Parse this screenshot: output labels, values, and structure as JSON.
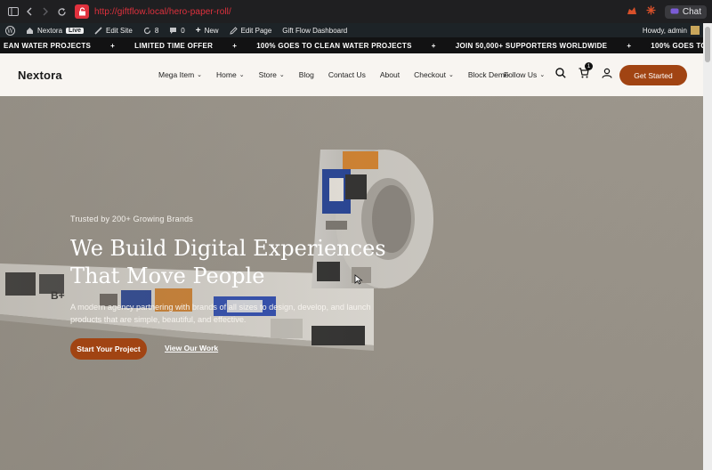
{
  "browser": {
    "url": "http://giftflow.local/hero-paper-roll/",
    "chat_label": "Chat"
  },
  "admin_bar": {
    "site_name": "Nextora",
    "live_badge": "Live",
    "edit_site": "Edit Site",
    "updates_count": "8",
    "comments_count": "0",
    "new_label": "New",
    "edit_page": "Edit Page",
    "dashboard": "Gift Flow Dashboard",
    "howdy": "Howdy, admin"
  },
  "ticker": {
    "items": [
      "EAN WATER PROJECTS",
      "LIMITED TIME OFFER",
      "100% GOES TO CLEAN WATER PROJECTS",
      "JOIN 50,000+ SUPPORTERS WORLDWIDE",
      "100% GOES TO CLEAN WATER PROJECTS"
    ],
    "separator": "+"
  },
  "header": {
    "logo": "Nextora",
    "nav": [
      {
        "label": "Mega Item",
        "has_dropdown": true
      },
      {
        "label": "Home",
        "has_dropdown": true
      },
      {
        "label": "Store",
        "has_dropdown": true
      },
      {
        "label": "Blog",
        "has_dropdown": false
      },
      {
        "label": "Contact Us",
        "has_dropdown": false
      },
      {
        "label": "About",
        "has_dropdown": false
      },
      {
        "label": "Checkout",
        "has_dropdown": true
      },
      {
        "label": "Block Demo",
        "has_dropdown": false
      }
    ],
    "follow_us": "Follow Us",
    "cart_count": "1",
    "cta": "Get Started"
  },
  "hero": {
    "trusted": "Trusted by 200+ Growing Brands",
    "headline_line1": "We Build Digital Experiences",
    "headline_line2": "That Move People",
    "subtext": "A modern agency partnering with brands of all sizes to design, develop, and launch products that are simple, beautiful, and effective.",
    "primary_cta": "Start Your Project",
    "secondary_cta": "View Our Work",
    "paper_label": "B+"
  },
  "colors": {
    "accent": "#a14413",
    "url_red": "#e0313d",
    "hero_bg": "#9d978d",
    "header_bg": "#f8f5f1"
  }
}
